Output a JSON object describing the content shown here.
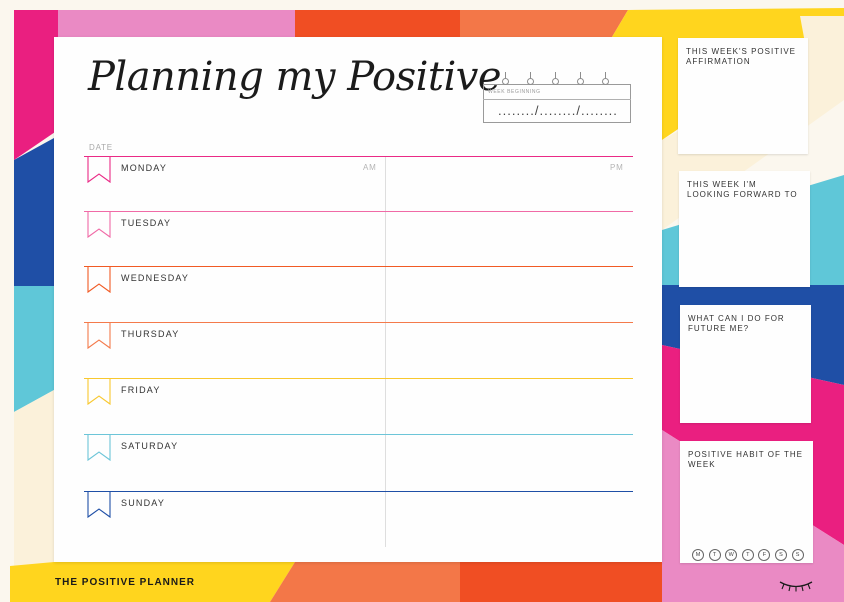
{
  "planner": {
    "title": "Planning my Positive",
    "week_label": "WEEK BEGINNING",
    "week_date": "......../......../........",
    "date_label": "DATE",
    "am_label": "AM",
    "pm_label": "PM",
    "days": [
      {
        "label": "MONDAY",
        "color": "#ea2a86"
      },
      {
        "label": "TUESDAY",
        "color": "#f06aa6"
      },
      {
        "label": "WEDNESDAY",
        "color": "#f15a24"
      },
      {
        "label": "THURSDAY",
        "color": "#f47a4b"
      },
      {
        "label": "FRIDAY",
        "color": "#f8c82e"
      },
      {
        "label": "SATURDAY",
        "color": "#6cc5d8"
      },
      {
        "label": "SUNDAY",
        "color": "#1f4fa6"
      }
    ]
  },
  "footer": {
    "brand": "THE POSITIVE PLANNER"
  },
  "cards": {
    "affirmation": "THIS WEEK'S POSITIVE AFFIRMATION",
    "forward": "THIS WEEK I'M LOOKING FORWARD TO",
    "future": "WHAT CAN I DO FOR FUTURE ME?",
    "habit": "POSITIVE HABIT OF THE WEEK",
    "habit_days": [
      "M",
      "T",
      "W",
      "T",
      "F",
      "S",
      "S"
    ]
  },
  "colors": {
    "pink": "#e91e7f",
    "light_pink": "#e887c4",
    "orange_red": "#f04e23",
    "orange": "#f37748",
    "yellow": "#ffd51e",
    "blue": "#1f4fa6",
    "sky": "#5fc7d8",
    "cream": "#fbf7ee"
  },
  "icons": {
    "footer_icon": "eyelash-icon",
    "day_marker": "bookmark-flag-icon",
    "calendar": "spiral-calendar-icon"
  }
}
